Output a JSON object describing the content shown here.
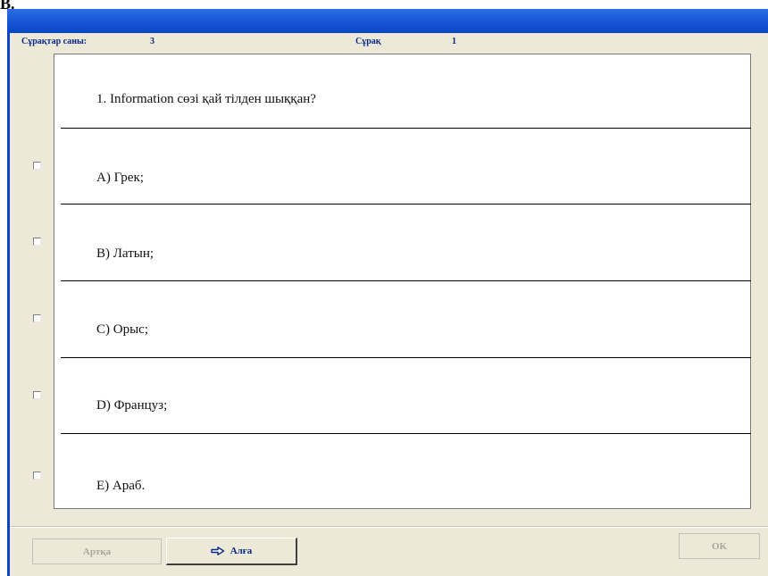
{
  "corner_label": "B.",
  "header": {
    "questions_count_label": "Сұрақтар саны:",
    "questions_count_value": "3",
    "question_label": "Сұрақ",
    "question_number": "1"
  },
  "question": {
    "text": "1. Information сөзі қай тілден шыққан?"
  },
  "options": [
    {
      "label": "A) Грек;",
      "checked": false
    },
    {
      "label": "B) Латын;",
      "checked": false
    },
    {
      "label": "C) Орыс;",
      "checked": false
    },
    {
      "label": "D) Француз;",
      "checked": false
    },
    {
      "label": "E)  Араб.",
      "checked": false
    }
  ],
  "buttons": {
    "back": "Артқа",
    "next": "Алға",
    "ok": "OK"
  },
  "colors": {
    "titlebar": "#0a47c8",
    "window_bg": "#ece9d8",
    "label_blue": "#0a2a8a"
  },
  "icons": {
    "next_icon": "right-arrow-icon"
  }
}
